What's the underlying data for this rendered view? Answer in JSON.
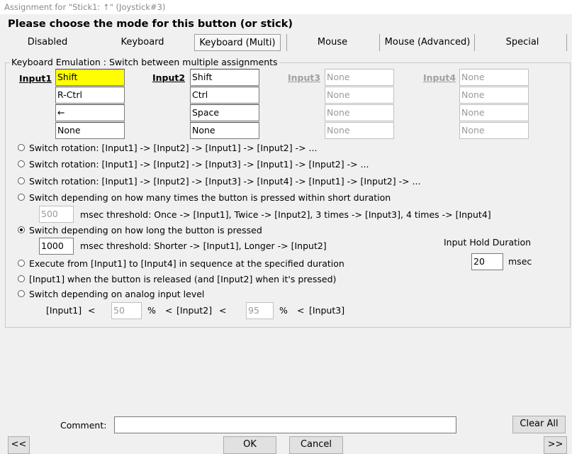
{
  "window": {
    "title": "Assignment for \"Stick1: ↑\" (Joystick#3)"
  },
  "heading": "Please choose the mode for this button (or stick)",
  "tabs": [
    "Disabled",
    "Keyboard",
    "Keyboard (Multi)",
    "Mouse",
    "Mouse (Advanced)",
    "Special"
  ],
  "active_tab": "Keyboard (Multi)",
  "group_label": "Keyboard Emulation : Switch between multiple assignments",
  "inputs": [
    {
      "label": "Input1",
      "values": [
        "Shift",
        "R-Ctrl",
        "←",
        "None"
      ]
    },
    {
      "label": "Input2",
      "values": [
        "Shift",
        "Ctrl",
        "Space",
        "None"
      ]
    },
    {
      "label": "Input3",
      "values": [
        "None",
        "None",
        "None",
        "None"
      ]
    },
    {
      "label": "Input4",
      "values": [
        "None",
        "None",
        "None",
        "None"
      ]
    }
  ],
  "options": [
    "Switch rotation: [Input1] -> [Input2] -> [Input1] -> [Input2] -> ...",
    "Switch rotation: [Input1] -> [Input2] -> [Input3] -> [Input1] -> [Input2] -> ...",
    "Switch rotation: [Input1] -> [Input2] -> [Input3] -> [Input4] -> [Input1] -> [Input2] -> ...",
    "Switch depending on how many times the button is pressed within short duration",
    "Switch depending on how long the button is pressed",
    "Execute from [Input1] to [Input4] in sequence at the specified duration",
    "[Input1] when the button is released (and [Input2] when it's pressed)",
    "Switch depending on analog input level"
  ],
  "selected_option": "Switch depending on how long the button is pressed",
  "press_count": {
    "value": "500",
    "text": "msec threshold: Once -> [Input1], Twice -> [Input2], 3 times -> [Input3], 4 times -> [Input4]"
  },
  "press_length": {
    "value": "1000",
    "text": "msec threshold: Shorter -> [Input1], Longer -> [Input2]"
  },
  "hold_duration": {
    "label": "Input Hold Duration",
    "value": "20",
    "unit": "msec"
  },
  "analog": {
    "input1": "[Input1]",
    "lt1": "<",
    "low": "50",
    "pct1": "%",
    "lt2": "<",
    "input2": "[Input2]",
    "lt3": "<",
    "high": "95",
    "pct2": "%",
    "lt4": "<",
    "input3": "[Input3]"
  },
  "comment": {
    "label": "Comment:",
    "value": ""
  },
  "buttons": {
    "clear_all": "Clear All",
    "prev": "<<",
    "ok": "OK",
    "cancel": "Cancel",
    "next": ">>"
  }
}
